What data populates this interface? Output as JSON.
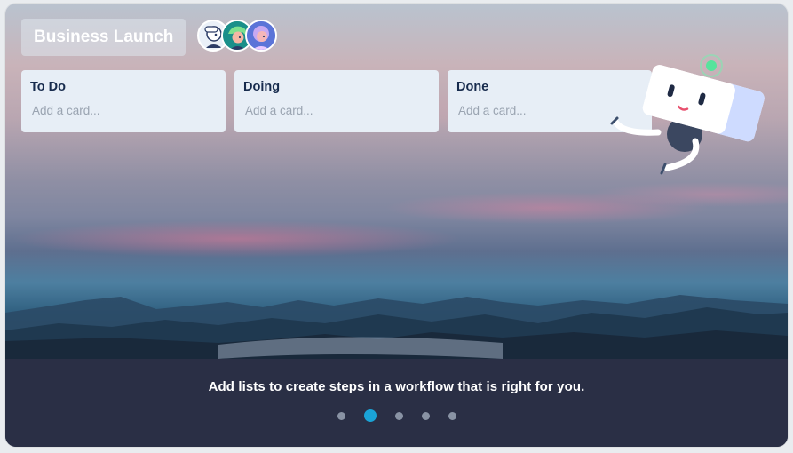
{
  "board": {
    "title": "Business Launch",
    "members": [
      "member-1-avatar",
      "member-2-avatar",
      "member-3-avatar"
    ]
  },
  "lists": [
    {
      "title": "To Do",
      "placeholder": "Add a card..."
    },
    {
      "title": "Doing",
      "placeholder": "Add a card..."
    },
    {
      "title": "Done",
      "placeholder": "Add a card..."
    }
  ],
  "carousel": {
    "caption": "Add lists to create steps in a workflow that is right for you.",
    "slides": 5,
    "active_slide": 2
  },
  "colors": {
    "accent_dot": "#1aa3d6",
    "panel": "#2a2f45",
    "list_bg": "#e7eef6"
  },
  "icons": [
    "robot-mascot-icon"
  ]
}
